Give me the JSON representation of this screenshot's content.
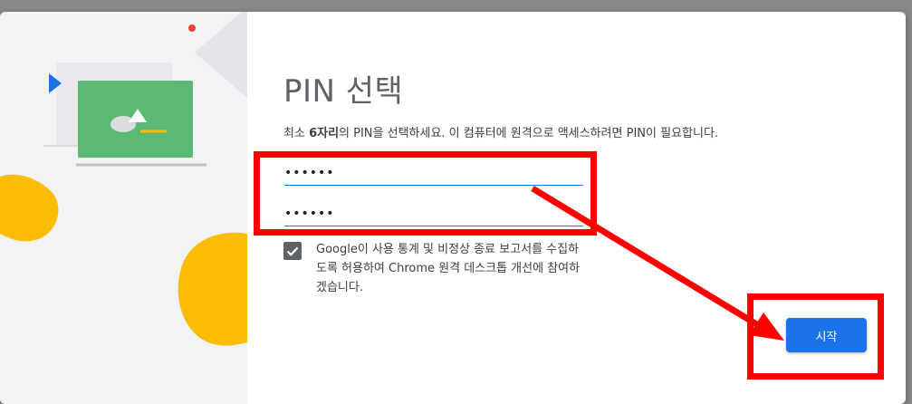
{
  "dialog": {
    "title": "PIN 선택",
    "description": {
      "part1": "최소 ",
      "bold": "6자리",
      "part2": "의 PIN을 선택하세요. 이 컴퓨터에 원격으로 액세스하려면 PIN이 필요합니다."
    },
    "pin_field_1": {
      "value": "••••••"
    },
    "pin_field_2": {
      "value": "••••••"
    },
    "consent_checkbox": {
      "checked": true
    },
    "consent_text": "Google이 사용 통계 및 비정상 종료 보고서를 수집하도록 허용하여 Chrome 원격 데스크톱 개선에 참여하겠습니다.",
    "start_button": "시작"
  },
  "colors": {
    "accent": "#1a73e8",
    "annotation": "#ff0000",
    "illustration_green": "#5bb974",
    "illustration_yellow": "#fbbc04"
  },
  "icons": {
    "checkbox": "check-icon",
    "illustration": "remote-desktop-illustration"
  }
}
